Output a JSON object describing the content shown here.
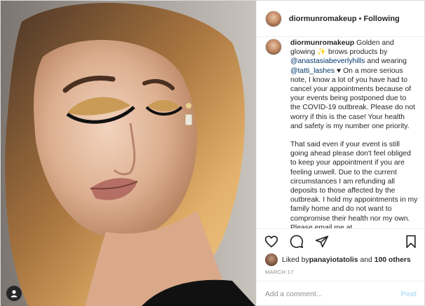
{
  "header": {
    "username": "diormunromakeup",
    "separator": "•",
    "follow_status": "Following"
  },
  "caption": {
    "username": "diormunromakeup",
    "t1": " Golden and glowing ✨ brows products by ",
    "mention1": "@anastasiabeverlyhills",
    "t2": " and wearing ",
    "mention2": "@tatti_lashes",
    "t3": " ♥ On a more serious note, I know a lot of you have had to cancel your appointments because of your events being postponed due to the COVID-19 outbreak. Please do not worry if this is the case! Your health and safety is my number one priority.",
    "p2": "That said even if your event is still going ahead please don't feel obliged to keep your appointment if you are feeling unwell. Due to the current circumstances I am refunding all deposits to those affected by the outbreak. I hold my appointments in my family home and do not want to compromise their health nor my own. Please email me at"
  },
  "actions": {
    "icons": [
      "heart-icon",
      "comment-icon",
      "share-icon",
      "bookmark-icon"
    ]
  },
  "likes": {
    "prefix": "Liked by ",
    "user": "panayiotatolis",
    "and": " and ",
    "others": "100 others"
  },
  "date": "MARCH 17",
  "comment_box": {
    "placeholder": "Add a comment...",
    "post_label": "Post"
  },
  "colors": {
    "link": "#00376b",
    "post_disabled": "#b2dffc",
    "muted": "#8e8e8e"
  }
}
